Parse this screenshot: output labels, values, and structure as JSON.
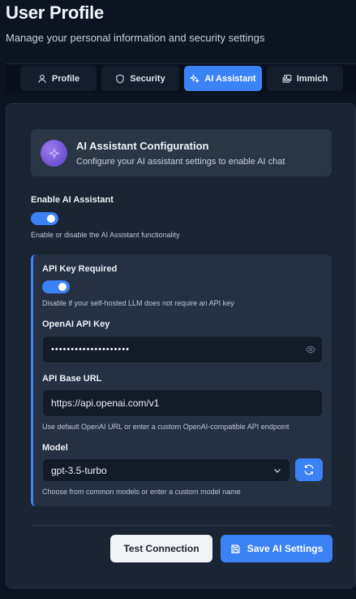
{
  "header": {
    "title": "User Profile",
    "subtitle": "Manage your personal information and security settings"
  },
  "tabs": [
    {
      "label": "Profile",
      "icon": "user-icon",
      "active": false
    },
    {
      "label": "Security",
      "icon": "shield-icon",
      "active": false
    },
    {
      "label": "AI Assistant",
      "icon": "sparkles-icon",
      "active": true
    },
    {
      "label": "Immich",
      "icon": "images-icon",
      "active": false
    }
  ],
  "banner": {
    "title": "AI Assistant Configuration",
    "description": "Configure your AI assistant settings to enable AI chat",
    "icon": "sparkle-icon"
  },
  "enable_ai": {
    "label": "Enable AI Assistant",
    "enabled": true,
    "hint": "Enable or disable the AI Assistant functionality"
  },
  "api_key_required": {
    "label": "API Key Required",
    "enabled": true,
    "hint": "Disable if your self-hosted LLM does not require an API key"
  },
  "openai_key": {
    "label": "OpenAI API Key",
    "value": "••••••••••••••••••••"
  },
  "base_url": {
    "label": "API Base URL",
    "value": "https://api.openai.com/v1",
    "hint": "Use default OpenAI URL or enter a custom OpenAI-compatible API endpoint"
  },
  "model": {
    "label": "Model",
    "value": "gpt-3.5-turbo",
    "hint": "Choose from common models or enter a custom model name"
  },
  "actions": {
    "test_label": "Test Connection",
    "save_label": "Save AI Settings"
  },
  "colors": {
    "accent": "#3b82f6",
    "background": "#0d1421",
    "card": "#1a2433"
  }
}
